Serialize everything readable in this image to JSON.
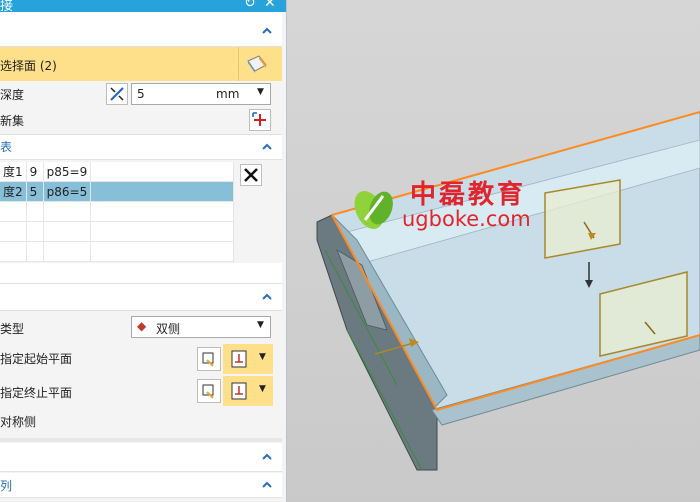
{
  "dialog": {
    "title": "接",
    "select_face": {
      "label": "选择面 (2)"
    },
    "depth": {
      "label": "深度",
      "value": "5",
      "unit": "mm"
    },
    "new_set": {
      "label": "新集"
    },
    "list_header": "表",
    "list_rows": [
      {
        "name": "度1",
        "count": "9",
        "expr": "p85=9"
      },
      {
        "name": "度2",
        "count": "5",
        "expr": "p86=5"
      }
    ],
    "type": {
      "label": "类型",
      "value": "双侧"
    },
    "start_plane": {
      "label": "指定起始平面"
    },
    "end_plane": {
      "label": "指定终止平面"
    },
    "symmetric": {
      "label": "对称侧"
    },
    "bottom_section": {
      "label": "列"
    }
  },
  "watermark": {
    "cn": "中磊教育",
    "en": "ugboke.com"
  },
  "colors": {
    "accent": "#27a3dc",
    "highlight": "#ffe08a",
    "selection": "#87bfd8",
    "edge": "#ff8a1f"
  }
}
